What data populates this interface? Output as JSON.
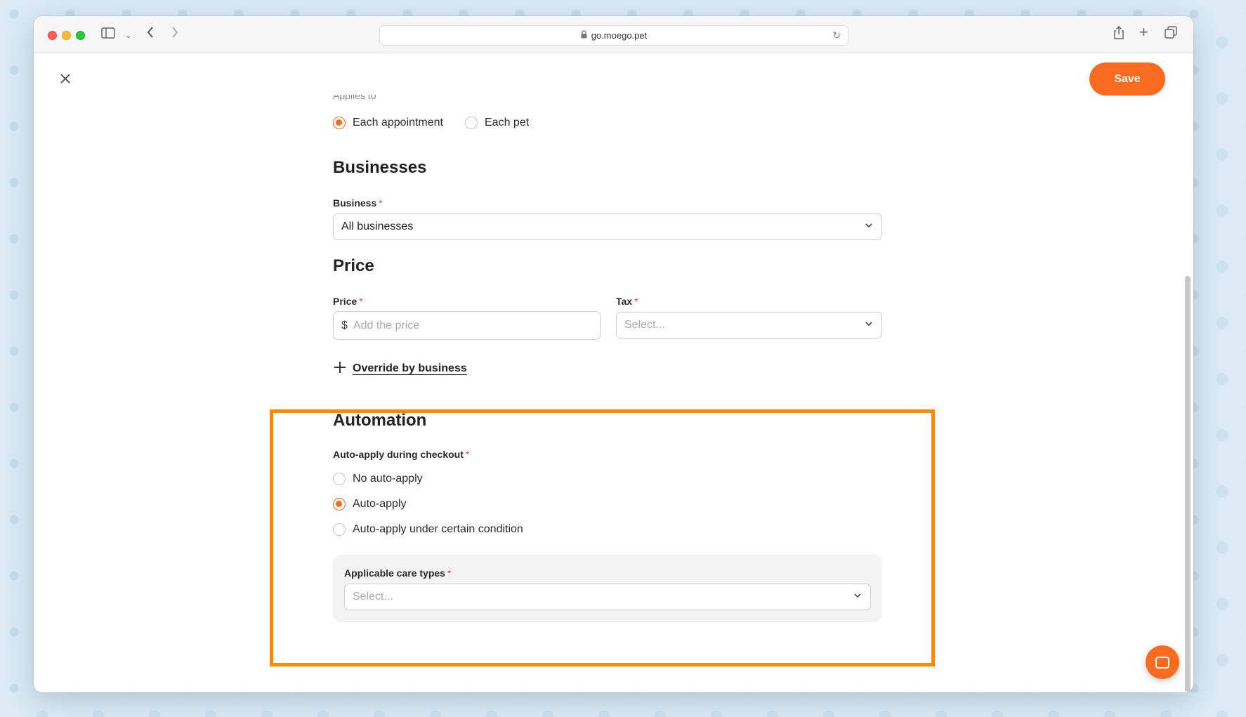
{
  "browser": {
    "url": "go.moego.pet"
  },
  "page": {
    "save_label": "Save",
    "partial_label": "Applies to",
    "apply_options": [
      {
        "label": "Each appointment",
        "checked": true
      },
      {
        "label": "Each pet",
        "checked": false
      }
    ],
    "businesses": {
      "heading": "Businesses",
      "field_label": "Business",
      "value": "All businesses"
    },
    "price": {
      "heading": "Price",
      "price_label": "Price",
      "price_prefix": "$",
      "price_placeholder": "Add the price",
      "tax_label": "Tax",
      "tax_placeholder": "Select..."
    },
    "override_label": "Override by business",
    "automation": {
      "heading": "Automation",
      "field_label": "Auto-apply during checkout",
      "options": [
        {
          "label": "No auto-apply",
          "checked": false
        },
        {
          "label": "Auto-apply",
          "checked": true
        },
        {
          "label": "Auto-apply under certain condition",
          "checked": false
        }
      ],
      "care_types_label": "Applicable care types",
      "care_types_placeholder": "Select..."
    },
    "required_mark": "*"
  },
  "colors": {
    "accent": "#f96b1f",
    "highlight": "#ff8a00",
    "required": "#e5484d"
  }
}
